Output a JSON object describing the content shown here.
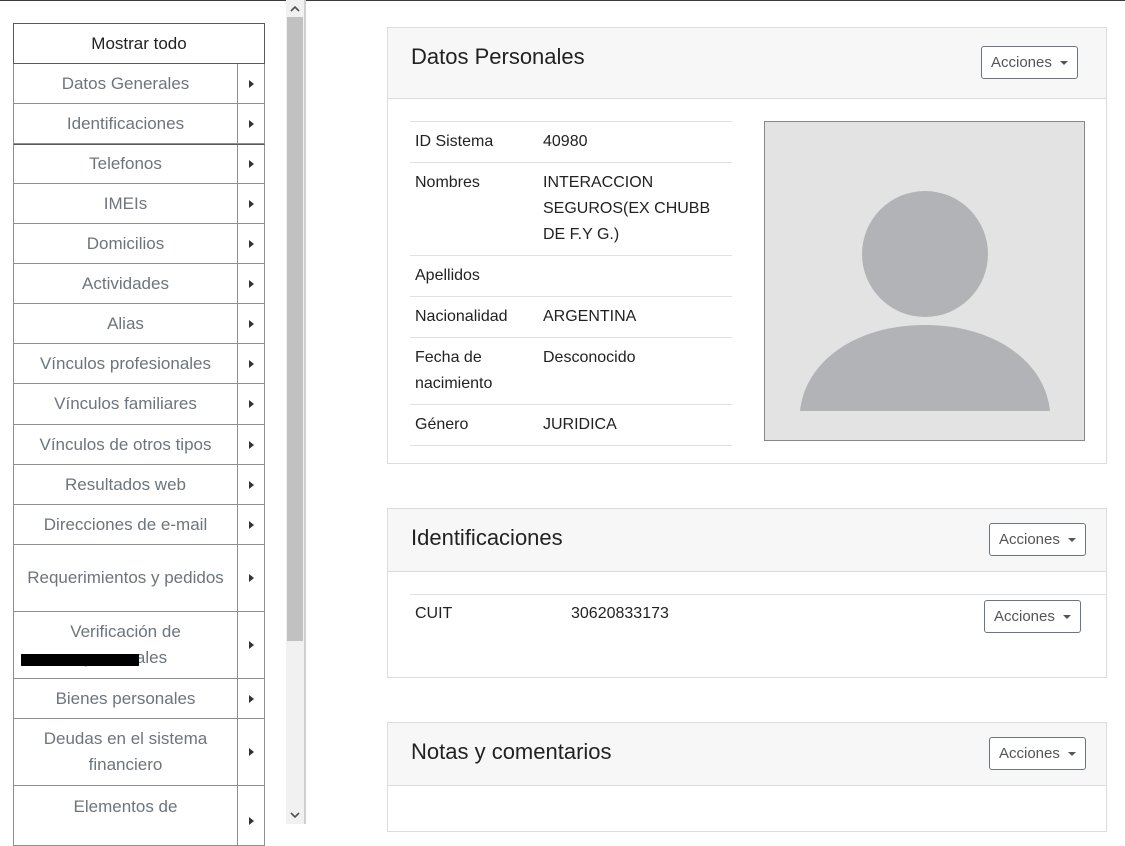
{
  "sidebar": {
    "show_all": "Mostrar todo",
    "items": [
      {
        "label": "Datos Generales"
      },
      {
        "label": "Identificaciones"
      },
      {
        "label": "Telefonos"
      },
      {
        "label": "IMEIs"
      },
      {
        "label": "Domicilios"
      },
      {
        "label": "Actividades"
      },
      {
        "label": "Alias"
      },
      {
        "label": "Vínculos profesionales"
      },
      {
        "label": "Vínculos familiares"
      },
      {
        "label": "Vínculos de otros tipos"
      },
      {
        "label": "Resultados web"
      },
      {
        "label": "Direcciones de e-mail"
      },
      {
        "label": "Requerimientos y pedidos"
      },
      {
        "label": "Verificación de personales"
      },
      {
        "label": "Bienes personales"
      },
      {
        "label": "Deudas en el sistema financiero"
      },
      {
        "label": "Elementos de"
      }
    ]
  },
  "datos_personales": {
    "title": "Datos Personales",
    "actions_label": "Acciones",
    "fields": [
      {
        "key": "ID Sistema",
        "value": "40980"
      },
      {
        "key": "Nombres",
        "value": "INTERACCION SEGUROS(EX CHUBB DE F.Y G.)"
      },
      {
        "key": "Apellidos",
        "value": ""
      },
      {
        "key": "Nacionalidad",
        "value": "ARGENTINA"
      },
      {
        "key": "Fecha de nacimiento",
        "value": "Desconocido"
      },
      {
        "key": "Género",
        "value": "JURIDICA"
      }
    ]
  },
  "identificaciones": {
    "title": "Identificaciones",
    "actions_label": "Acciones",
    "rows": [
      {
        "type": "CUIT",
        "value": "30620833173",
        "actions_label": "Acciones"
      }
    ]
  },
  "notas": {
    "title": "Notas y comentarios",
    "actions_label": "Acciones"
  },
  "colors": {
    "header_bg": "#f7f7f7",
    "sidebar_text": "#6c757d",
    "avatar_bg": "#e3e3e3",
    "avatar_fg": "#b1b3b6"
  }
}
